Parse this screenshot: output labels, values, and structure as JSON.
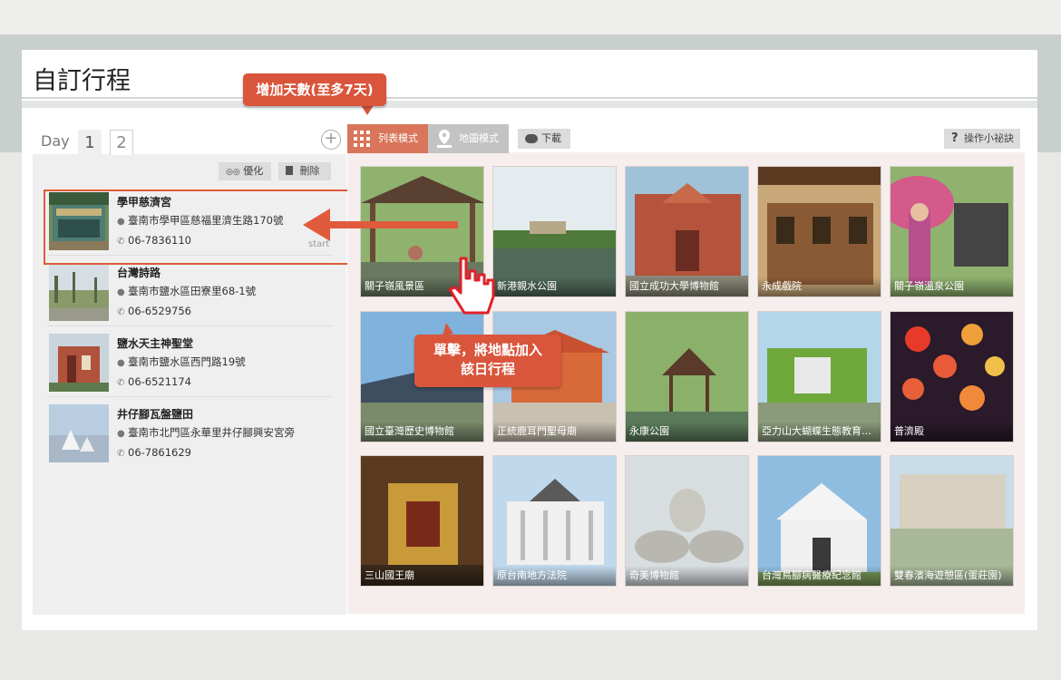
{
  "page_title": "自訂行程",
  "day_tabs": {
    "label": "Day",
    "tabs": [
      "1",
      "2"
    ],
    "active_index": 0,
    "add_symbol": "+"
  },
  "left_toolbar": {
    "optimize_label": "優化",
    "delete_label": "刪除"
  },
  "itinerary": [
    {
      "name": "學甲慈濟宮",
      "address": "臺南市學甲區慈福里濟生路170號",
      "phone": "06-7836110",
      "tag": "start"
    },
    {
      "name": "台灣詩路",
      "address": "臺南市鹽水區田寮里68-1號",
      "phone": "06-6529756"
    },
    {
      "name": "鹽水天主神聖堂",
      "address": "臺南市鹽水區西門路19號",
      "phone": "06-6521174"
    },
    {
      "name": "井仔腳瓦盤鹽田",
      "address": "臺南市北門區永華里井仔腳興安宮旁",
      "phone": "06-7861629"
    }
  ],
  "modes": {
    "list_label": "列表模式",
    "map_label": "地圖模式",
    "download_label": "下載",
    "help_label": "操作小祕訣"
  },
  "tiles": [
    "關子嶺風景區",
    "新港親水公園",
    "國立成功大學博物館",
    "永成戲院",
    "關子嶺溫泉公園",
    "國立臺灣歷史博物館",
    "正統鹿耳門聖母廟",
    "永康公園",
    "亞力山大蝴蝶生態教育…",
    "普濟殿",
    "三山國王廟",
    "原台南地方法院",
    "奇美博物館",
    "台灣鳥腳病醫療紀念館",
    "雙春濱海遊憩區(蛋莊園)"
  ],
  "callouts": {
    "add_days": "增加天數(至多7天)",
    "click_add_line1": "單擊，將地點加入",
    "click_add_line2": "該日行程"
  },
  "colors": {
    "accent": "#d9553c",
    "list_mode": "#d9755a",
    "map_mode": "#c3c3c3",
    "panel_bg": "#f6eeed"
  }
}
